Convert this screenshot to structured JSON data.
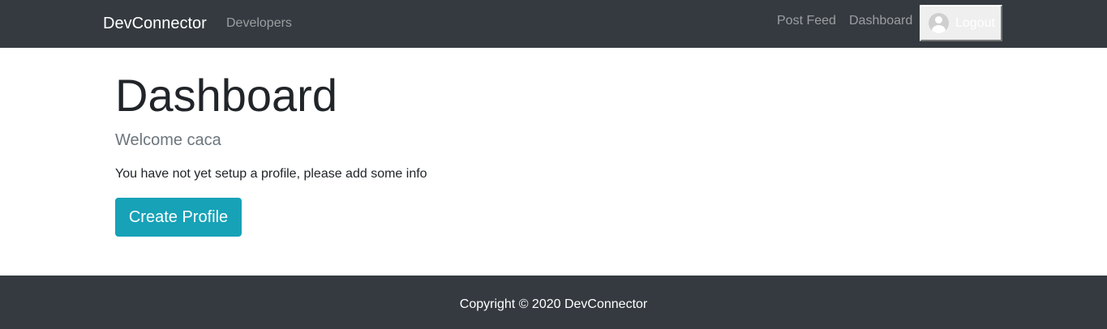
{
  "navbar": {
    "brand": "DevConnector",
    "developers_label": "Developers",
    "post_feed_label": "Post Feed",
    "dashboard_label": "Dashboard",
    "logout_label": "Logout"
  },
  "main": {
    "title": "Dashboard",
    "welcome": "Welcome caca",
    "info": "You have not yet setup a profile, please add some info",
    "create_profile_label": "Create Profile"
  },
  "footer": {
    "copyright": "Copyright © 2020 DevConnector"
  },
  "colors": {
    "navbar_bg": "#343a40",
    "accent": "#17a2b8",
    "muted_text": "#6c757d"
  }
}
